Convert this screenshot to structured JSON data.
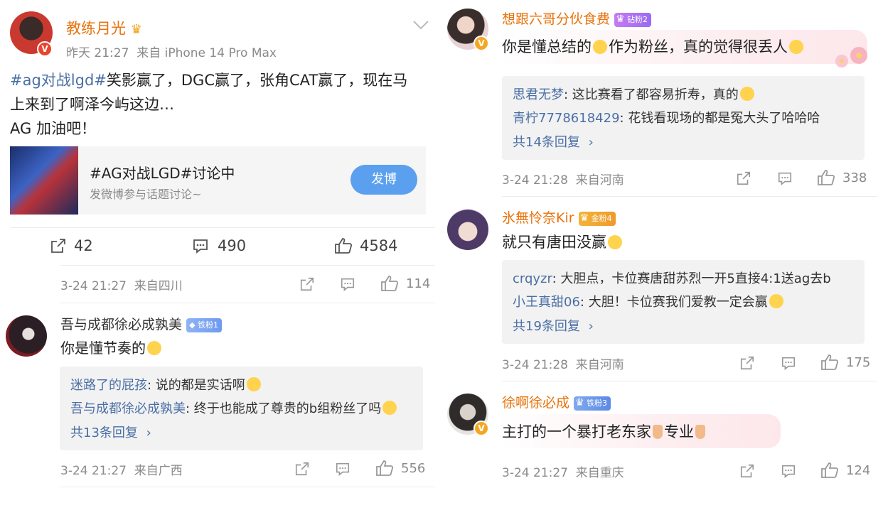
{
  "post": {
    "author": "教练月光",
    "time": "昨天 21:27",
    "source": "来自 iPhone 14 Pro Max",
    "hashtag": "#ag对战lgd#",
    "text_line1": "笑影赢了，DGC赢了，张角CAT赢了，现在马",
    "text_line2": "上来到了啊泽今屿这边…",
    "text_line3": "AG 加油吧！",
    "topic": {
      "title": "#AG对战LGD#讨论中",
      "subtitle": "发微博参与话题讨论~",
      "button": "发博"
    },
    "stats": {
      "reposts": "42",
      "comments": "490",
      "likes": "4584"
    }
  },
  "left_comments": [
    {
      "time": "3-24 21:27",
      "location": "来自四川",
      "likes": "114"
    },
    {
      "user": "吾与成都徐必成孰美",
      "badge": "铁粉1",
      "text": "你是懂节奏的",
      "replies": [
        {
          "user": "迷路了的屁孩",
          "text": ": 说的都是实话啊"
        },
        {
          "user": "吾与成都徐必成孰美",
          "text": ": 终于也能成了尊贵的b组粉丝了吗"
        }
      ],
      "more": "共13条回复",
      "time": "3-24 21:27",
      "location": "来自广西",
      "likes": "556"
    }
  ],
  "right_comments": [
    {
      "user": "想跟六哥分伙食费",
      "badge": "钻粉2",
      "text_a": "你是懂总结的",
      "text_b": "作为粉丝，真的觉得很丢人",
      "replies": [
        {
          "user": "思君无梦",
          "text": ": 这比赛看了都容易折寿，真的"
        },
        {
          "user": "青柠7778618429",
          "text": ": 花钱看现场的都是冤大头了哈哈哈"
        }
      ],
      "more": "共14条回复",
      "time": "3-24 21:28",
      "location": "来自河南",
      "likes": "338"
    },
    {
      "user": "氷無怜奈Kir",
      "badge": "金粉4",
      "text": "就只有唐田没赢",
      "replies": [
        {
          "user": "crqyzr",
          "text": ": 大胆点，卡位赛唐甜苏烈一开5直接4:1送ag去b"
        },
        {
          "user": "小王真甜06",
          "text": ": 大胆！卡位赛我们爱教一定会赢"
        }
      ],
      "more": "共19条回复",
      "time": "3-24 21:28",
      "location": "来自河南",
      "likes": "175"
    },
    {
      "user": "徐啊徐必成",
      "badge": "铁粉3",
      "text_a": "主打的一个暴打老东家",
      "text_b": "专业",
      "time": "3-24 21:27",
      "location": "来自重庆",
      "likes": "124"
    }
  ],
  "colors": {
    "orange_name": "#e8730d",
    "link": "#4a6fa5",
    "button": "#5aa0ee"
  }
}
